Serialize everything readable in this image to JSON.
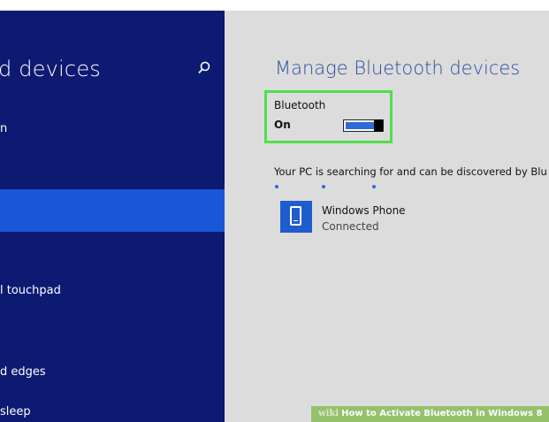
{
  "sidebar": {
    "title": "d devices",
    "items": [
      {
        "label": "n"
      },
      {
        "label": "l touchpad"
      },
      {
        "label": "d edges"
      },
      {
        "label": "sleep"
      }
    ],
    "search_icon": "search-icon"
  },
  "main": {
    "title": "Manage Bluetooth devices",
    "bluetooth": {
      "label": "Bluetooth",
      "state": "On",
      "toggle_on": true
    },
    "searching_text": "Your PC is searching for and can be discovered by Blu",
    "devices": [
      {
        "name": "Windows Phone",
        "status": "Connected",
        "icon": "phone-icon"
      }
    ]
  },
  "watermark": {
    "prefix": "wiki",
    "text": "How to Activate Bluetooth in Windows 8"
  },
  "colors": {
    "sidebar_bg": "#0d1a72",
    "selected_bg": "#1957d8",
    "main_bg": "#dcdcdc",
    "accent": "#2f6bd8",
    "highlight": "#4ee04b"
  }
}
